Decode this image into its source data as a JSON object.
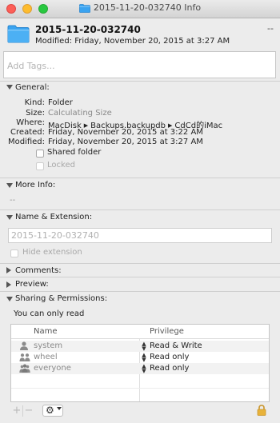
{
  "window": {
    "title": "2015-11-20-032740 Info"
  },
  "header": {
    "name": "2015-11-20-032740",
    "size": "--",
    "modified_line": "Modified: Friday, November 20, 2015 at 3:27 AM"
  },
  "tags": {
    "placeholder": "Add Tags..."
  },
  "general": {
    "title": "General:",
    "kind_label": "Kind:",
    "kind_value": "Folder",
    "size_label": "Size:",
    "size_value": "Calculating Size",
    "where_label": "Where:",
    "where_parts": [
      "MacDisk",
      "Backups.backupdb",
      "CdCd的iMac"
    ],
    "created_label": "Created:",
    "created_value": "Friday, November 20, 2015 at 3:22 AM",
    "modified_label": "Modified:",
    "modified_value": "Friday, November 20, 2015 at 3:27 AM",
    "shared_folder_label": "Shared folder",
    "locked_label": "Locked"
  },
  "more_info": {
    "title": "More Info:",
    "value": "--"
  },
  "name_ext": {
    "title": "Name & Extension:",
    "value": "2015-11-20-032740",
    "hide_extension_label": "Hide extension"
  },
  "comments": {
    "title": "Comments:"
  },
  "preview": {
    "title": "Preview:"
  },
  "sharing": {
    "title": "Sharing & Permissions:",
    "status": "You can only read",
    "columns": {
      "name": "Name",
      "privilege": "Privilege"
    },
    "rows": [
      {
        "name": "system",
        "privilege": "Read & Write",
        "icon": "user-icon"
      },
      {
        "name": "wheel",
        "privilege": "Read only",
        "icon": "group-icon"
      },
      {
        "name": "everyone",
        "privilege": "Read only",
        "icon": "everyone-icon"
      }
    ]
  },
  "icons": {
    "folder_color": "#3aa3f0",
    "close_color": "#fc5f57",
    "minimize_color": "#fdbc2e",
    "zoom_color": "#28c840"
  }
}
